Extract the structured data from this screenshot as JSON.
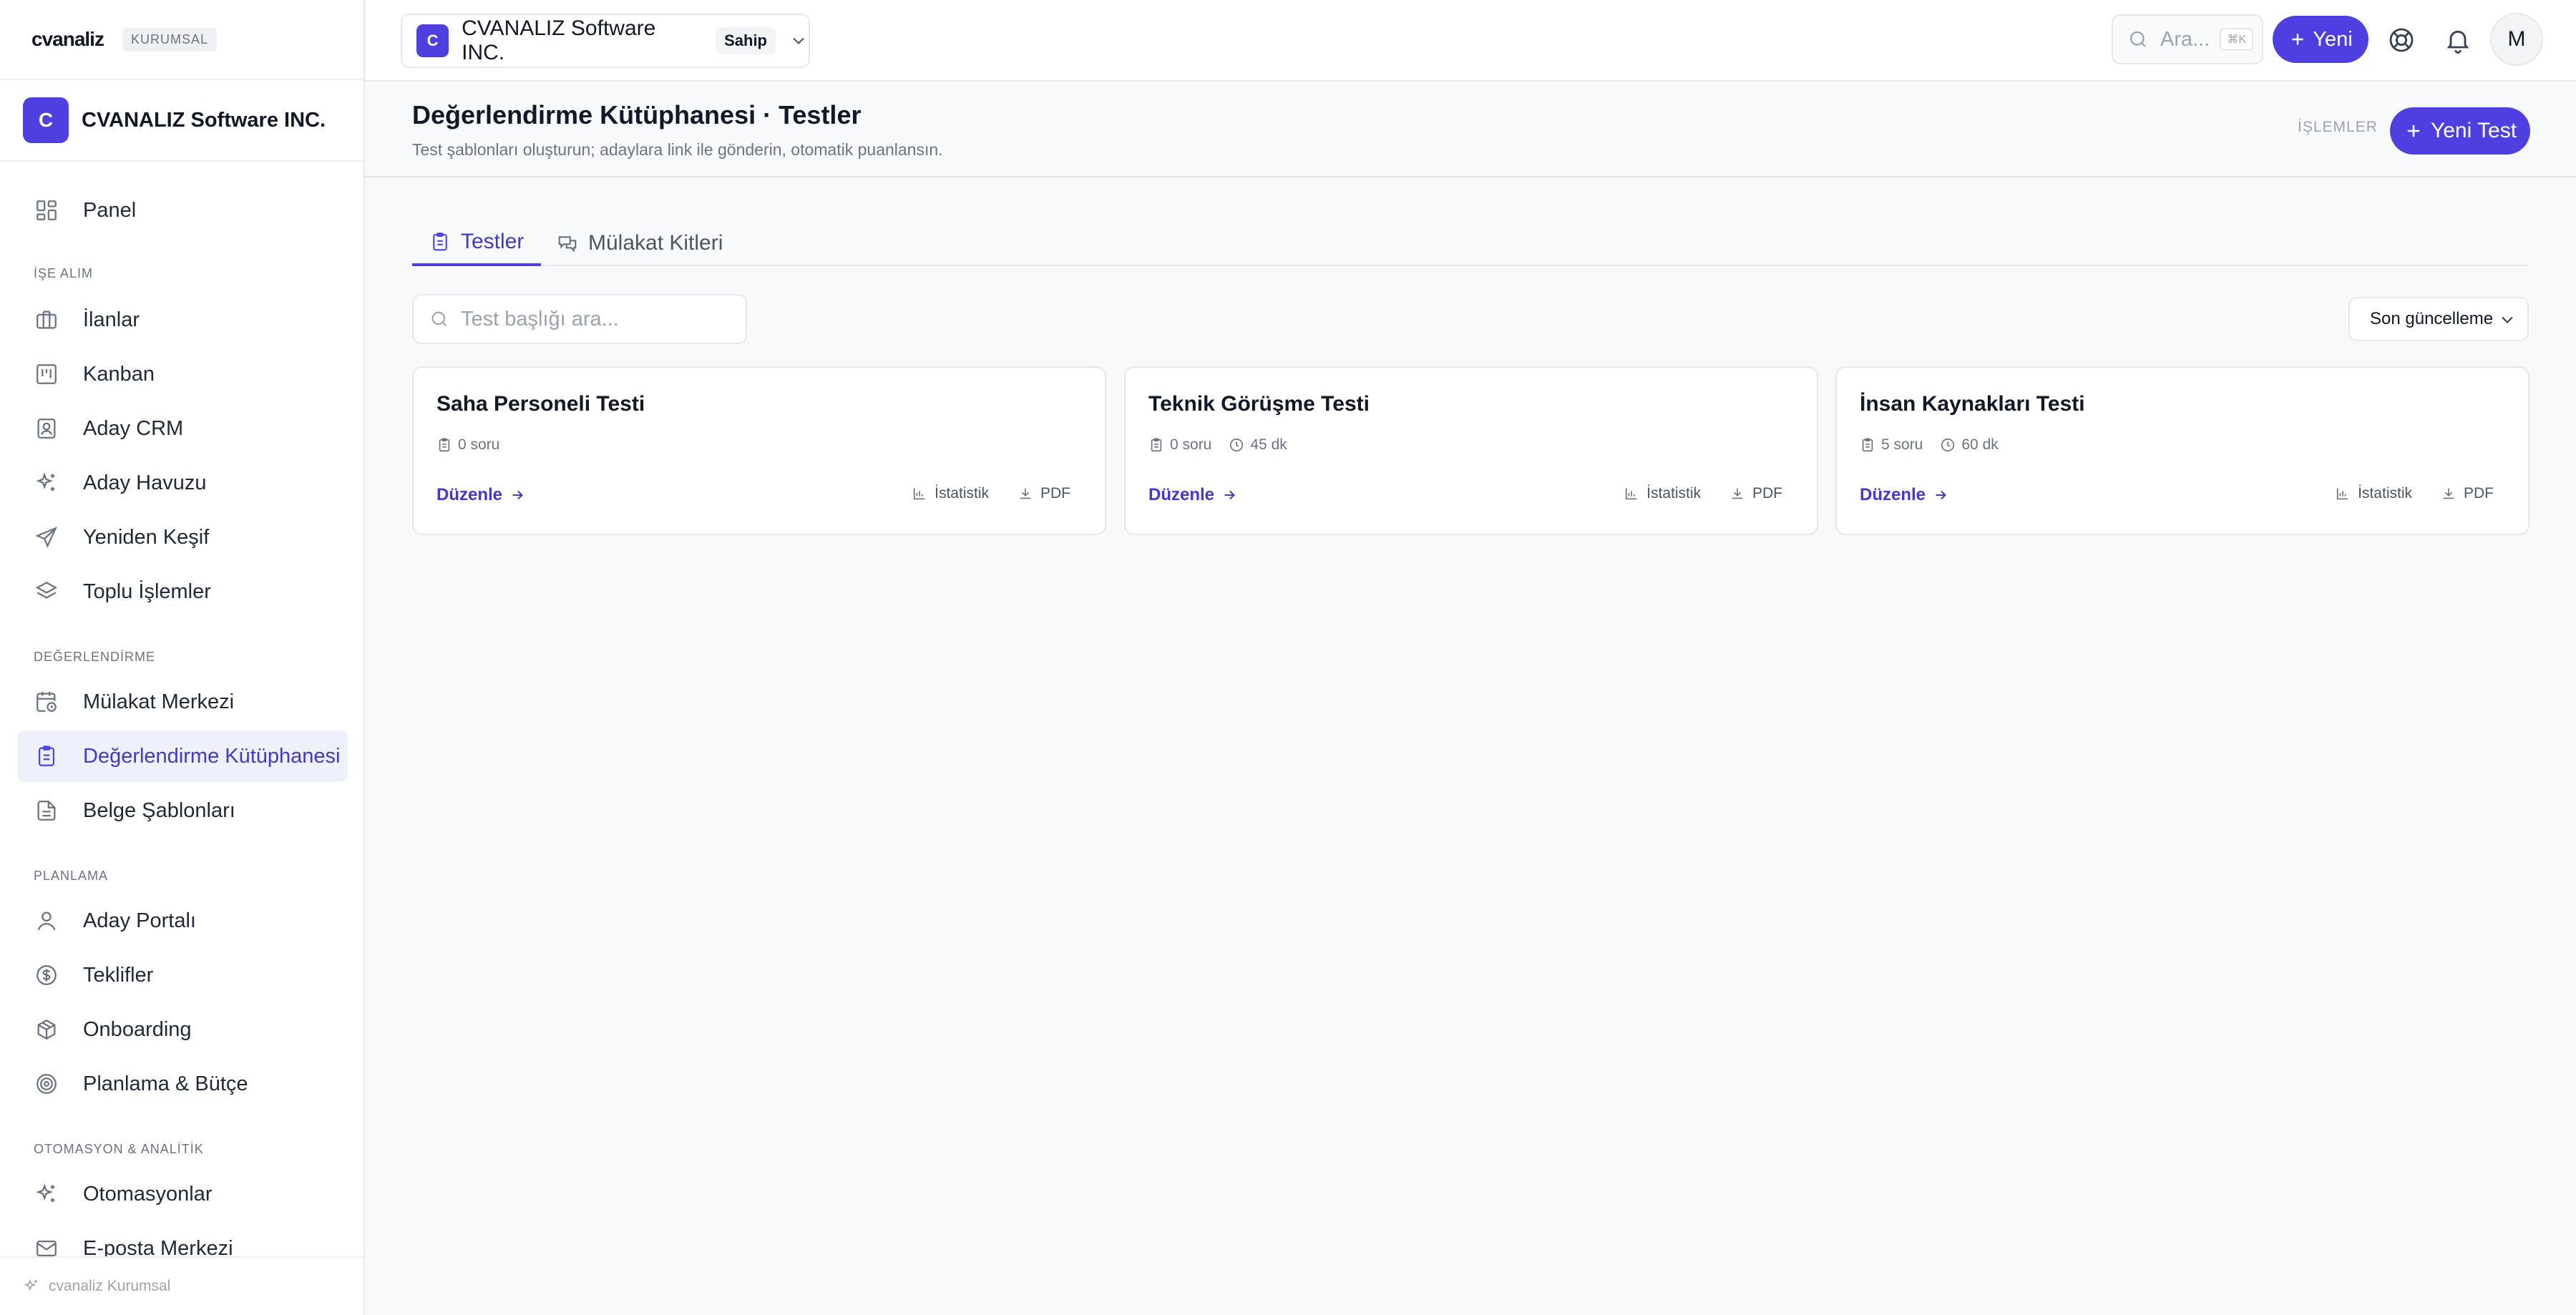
{
  "brand": {
    "logo_text": "cvanaliz",
    "badge": "KURUMSAL"
  },
  "org": {
    "initial": "C",
    "name": "CVANALIZ Software INC."
  },
  "nav": {
    "panel": "Panel",
    "section_recruit": "İŞE ALIM",
    "ilanlar": "İlanlar",
    "kanban": "Kanban",
    "aday_crm": "Aday CRM",
    "aday_havuzu": "Aday Havuzu",
    "yeniden_kesif": "Yeniden Keşif",
    "toplu_islemler": "Toplu İşlemler",
    "section_eval": "DEĞERLENDİRME",
    "mulakat_merkezi": "Mülakat Merkezi",
    "degerlendirme_kutuphanesi": "Değerlendirme Kütüphanesi",
    "belge_sablonlari": "Belge Şablonları",
    "section_plan": "PLANLAMA",
    "aday_portali": "Aday Portalı",
    "teklifler": "Teklifler",
    "onboarding": "Onboarding",
    "planlama_butce": "Planlama & Bütçe",
    "section_auto": "OTOMASYON & ANALİTİK",
    "otomasyonlar": "Otomasyonlar",
    "eposta_merkezi": "E-posta Merkezi",
    "active": "degerlendirme_kutuphanesi"
  },
  "sidebar_footer": "cvanaliz Kurumsal",
  "topbar": {
    "workspace_initial": "C",
    "workspace_name": "CVANALIZ Software INC.",
    "workspace_role": "Sahip",
    "search_placeholder": "Ara...",
    "search_shortcut": "⌘K",
    "new_button": "Yeni",
    "user_initial": "M"
  },
  "page": {
    "title": "Değerlendirme Kütüphanesi · Testler",
    "subtitle": "Test şablonları oluşturun; adaylara link ile gönderin, otomatik puanlansın.",
    "actions_label": "İŞLEMLER",
    "new_test_button": "Yeni Test"
  },
  "tabs": [
    {
      "label": "Testler",
      "active": true
    },
    {
      "label": "Mülakat Kitleri",
      "active": false
    }
  ],
  "list": {
    "search_placeholder": "Test başlığı ara...",
    "sort_value": "Son güncelleme"
  },
  "cards": [
    {
      "title": "Saha Personeli Testi",
      "questions": "0 soru",
      "duration": "",
      "edit": "Düzenle",
      "stats": "İstatistik",
      "pdf": "PDF"
    },
    {
      "title": "Teknik Görüşme Testi",
      "questions": "0 soru",
      "duration": "45 dk",
      "edit": "Düzenle",
      "stats": "İstatistik",
      "pdf": "PDF"
    },
    {
      "title": "İnsan Kaynakları Testi",
      "questions": "5 soru",
      "duration": "60 dk",
      "edit": "Düzenle",
      "stats": "İstatistik",
      "pdf": "PDF"
    }
  ],
  "colors": {
    "accent": "#4f3fe0",
    "active_bg": "#eef0fc",
    "border": "#e5e7eb"
  }
}
